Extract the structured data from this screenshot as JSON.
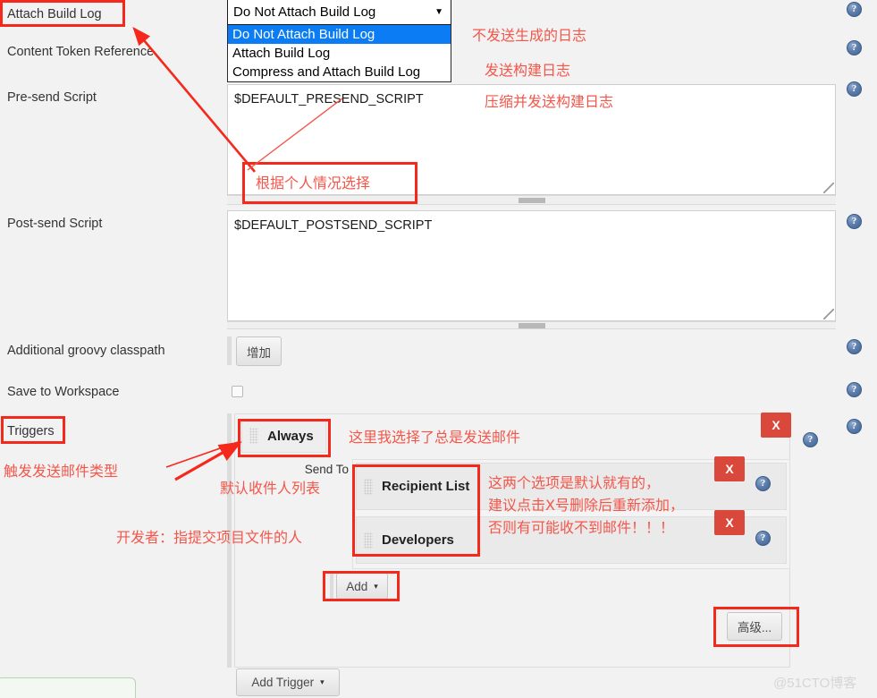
{
  "form": {
    "labels": {
      "attach_build_log": "Attach Build Log",
      "content_token_reference": "Content Token Reference",
      "pre_send_script": "Pre-send Script",
      "post_send_script": "Post-send Script",
      "additional_groovy_classpath": "Additional groovy classpath",
      "save_to_workspace": "Save to Workspace",
      "triggers": "Triggers"
    },
    "attach_build_log_select": {
      "value": "Do Not Attach Build Log",
      "expanded": true,
      "options": [
        "Do Not Attach Build Log",
        "Attach Build Log",
        "Compress and Attach Build Log"
      ],
      "selected_index": 0,
      "caret": "▼"
    },
    "pre_send_script": {
      "value": "$DEFAULT_PRESEND_SCRIPT"
    },
    "post_send_script": {
      "value": "$DEFAULT_POSTSEND_SCRIPT"
    },
    "additional_groovy_classpath": {
      "add_button_label": "增加"
    },
    "save_to_workspace": {
      "checked": false
    }
  },
  "triggers": {
    "trigger_name": "Always",
    "send_to_label": "Send To",
    "recipients": [
      {
        "name": "Recipient List",
        "delete_label": "X"
      },
      {
        "name": "Developers",
        "delete_label": "X"
      }
    ],
    "trigger_delete_label": "X",
    "add_recipient_button": {
      "label": "Add",
      "caret": "▾"
    },
    "advanced_button": {
      "label": "高级..."
    },
    "add_trigger_button": {
      "label": "Add Trigger",
      "caret": "▾"
    }
  },
  "help_icons": {
    "glyph": "?",
    "count": 7
  },
  "annotations": {
    "texts": [
      {
        "id": "no-send-log",
        "text": "不发送生成的日志"
      },
      {
        "id": "send-build-log",
        "text": "发送构建日志"
      },
      {
        "id": "compress-send",
        "text": "压缩并发送构建日志"
      },
      {
        "id": "choose-yourself",
        "text": "根据个人情况选择"
      },
      {
        "id": "always-note",
        "text": "这里我选择了总是发送邮件"
      },
      {
        "id": "trigger-type",
        "text": "触发发送邮件类型"
      },
      {
        "id": "default-list",
        "text": "默认收件人列表"
      },
      {
        "id": "developer-note",
        "text": "开发者：指提交项目文件的人"
      },
      {
        "id": "default-warning-1",
        "text": "这两个选项是默认就有的，"
      },
      {
        "id": "default-warning-2",
        "text": "建议点击X号删除后重新添加，"
      },
      {
        "id": "default-warning-3",
        "text": "否则有可能收不到邮件！！！"
      }
    ],
    "colors": {
      "annotation_red": "#f4564a",
      "box_red": "#f4291c",
      "delete_button_red": "#d9483b",
      "select_highlight_blue": "#0c7cf4"
    }
  },
  "watermark": {
    "text": "@51CTO博客"
  }
}
